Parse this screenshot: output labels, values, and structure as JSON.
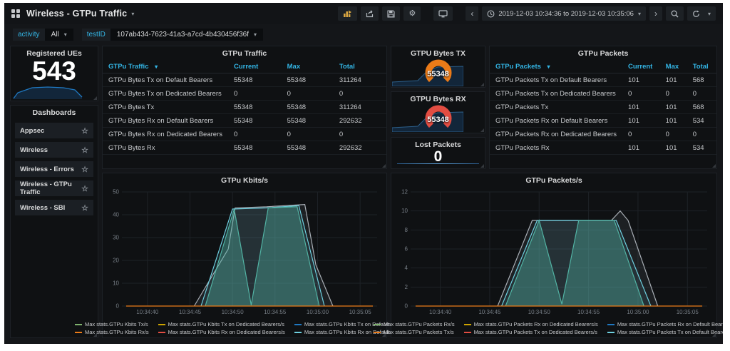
{
  "topnav": {
    "title": "Wireless - GTPu Traffic",
    "time_range": "2019-12-03 10:34:36 to 2019-12-03 10:35:06",
    "icons": [
      "add-panel",
      "share",
      "save",
      "settings",
      "cycle-view",
      "back",
      "clock",
      "forward",
      "zoom-out",
      "refresh"
    ]
  },
  "variables": [
    {
      "label": "activity",
      "value": "All"
    },
    {
      "label": "testID",
      "value": "107ab434-7623-41a3-a7cd-4b430456f36f"
    }
  ],
  "sidebar": {
    "registered_ues": {
      "title": "Registered UEs",
      "value": "543"
    },
    "dashboards": {
      "title": "Dashboards",
      "items": [
        "Appsec",
        "Wireless",
        "Wireless - Errors",
        "Wireless - GTPu Traffic",
        "Wireless - SBI"
      ]
    }
  },
  "traffic_table": {
    "title": "GTPu Traffic",
    "columns": [
      "GTPu Traffic",
      "Current",
      "Max",
      "Total"
    ],
    "rows": [
      {
        "name": "GTPu Bytes Tx on Default Bearers",
        "current": "55348",
        "max": "55348",
        "total": "311264"
      },
      {
        "name": "GTPu Bytes Tx on Dedicated Bearers",
        "current": "0",
        "max": "0",
        "total": "0"
      },
      {
        "name": "GTPu Bytes Tx",
        "current": "55348",
        "max": "55348",
        "total": "311264"
      },
      {
        "name": "GTPu Bytes Rx on Default Bearers",
        "current": "55348",
        "max": "55348",
        "total": "292632"
      },
      {
        "name": "GTPu Bytes Rx on Dedicated Bearers",
        "current": "0",
        "max": "0",
        "total": "0"
      },
      {
        "name": "GTPu Bytes Rx",
        "current": "55348",
        "max": "55348",
        "total": "292632"
      }
    ]
  },
  "packets_table": {
    "title": "GTPu Packets",
    "columns": [
      "GTPu Packets",
      "Current",
      "Max",
      "Total"
    ],
    "rows": [
      {
        "name": "GTPu Packets Tx on Default Bearers",
        "current": "101",
        "max": "101",
        "total": "568"
      },
      {
        "name": "GTPu Packets Tx on Dedicated Bearers",
        "current": "0",
        "max": "0",
        "total": "0"
      },
      {
        "name": "GTPu Packets Tx",
        "current": "101",
        "max": "101",
        "total": "568"
      },
      {
        "name": "GTPu Packets Rx on Default Bearers",
        "current": "101",
        "max": "101",
        "total": "534"
      },
      {
        "name": "GTPu Packets Rx on Dedicated Bearers",
        "current": "0",
        "max": "0",
        "total": "0"
      },
      {
        "name": "GTPu Packets Rx",
        "current": "101",
        "max": "101",
        "total": "534"
      }
    ]
  },
  "singlestats": {
    "tx": {
      "title": "GTPU Bytes TX",
      "value": "55348",
      "color": "#eb7b18"
    },
    "rx": {
      "title": "GTPU Bytes RX",
      "value": "55348",
      "color": "#e24d42"
    },
    "lost": {
      "title": "Lost Packets",
      "value": "0"
    }
  },
  "colors": {
    "accent_blue": "#33b5e5",
    "spark_line": "#1f78c1",
    "spark_fill": "#12263a",
    "grid": "#1e2227",
    "axis_text": "#767d85"
  },
  "chart_data": [
    {
      "type": "area",
      "title": "GTPu Kbits/s",
      "xlabel": "",
      "ylabel": "",
      "ylim": [
        0,
        50
      ],
      "yticks": [
        0,
        10,
        20,
        30,
        40,
        50
      ],
      "x_domain_seconds": [
        37,
        67
      ],
      "xticks": [
        {
          "s": 40,
          "label": "10:34:40"
        },
        {
          "s": 45,
          "label": "10:34:45"
        },
        {
          "s": 50,
          "label": "10:34:50"
        },
        {
          "s": 55,
          "label": "10:34:55"
        },
        {
          "s": 60,
          "label": "10:35:00"
        },
        {
          "s": 65,
          "label": "10:35:05"
        }
      ],
      "legend": [
        {
          "label": "Max stats.GTPu Kbits Tx/s",
          "color": "#7eb26d"
        },
        {
          "label": "Max stats.GTPu Kbits Tx on Dedicated Bearers/s",
          "color": "#cca300"
        },
        {
          "label": "Max stats.GTPu Kbits Tx on Default Bearers/s",
          "color": "#1f78c1"
        },
        {
          "label": "Max stats.GTPu Kbits Rx/s",
          "color": "#eb7b18"
        },
        {
          "label": "Max stats.GTPu Kbits Rx on Dedicated Bearers/s",
          "color": "#e24d42"
        },
        {
          "label": "Max stats.GTPu Kbits Rx on Default Bearers/s",
          "color": "#6ed0e0"
        }
      ],
      "series": [
        {
          "name": "Max stats.GTPu Kbits Rx/s",
          "color": "#a8aeb5",
          "fill": "rgba(160,168,176,0.10)",
          "points": [
            [
              45.5,
              0
            ],
            [
              49.5,
              25
            ],
            [
              50.3,
              43
            ],
            [
              54,
              43.5
            ],
            [
              58.5,
              44.5
            ],
            [
              59.8,
              18
            ],
            [
              61.8,
              0
            ]
          ]
        },
        {
          "name": "Max stats.GTPu Kbits Tx/s",
          "color": "#6ed0e0",
          "fill": "rgba(110,208,224,0.10)",
          "points": [
            [
              46.3,
              0
            ],
            [
              50,
              42.5
            ],
            [
              54,
              43
            ],
            [
              57.8,
              44
            ],
            [
              60.8,
              0
            ]
          ]
        },
        {
          "name": "Max stats.GTPu Kbits Tx on Default Bearers/s",
          "color": "#52b3a4",
          "fill": "rgba(82,179,164,0.38)",
          "points": [
            [
              46.8,
              0
            ],
            [
              50.2,
              42.5
            ],
            [
              52.2,
              0.4
            ],
            [
              54.2,
              43
            ],
            [
              57.6,
              43.5
            ],
            [
              60.2,
              0
            ]
          ]
        },
        {
          "name": "Max stats.GTPu Kbits Tx on Dedicated Bearers/s",
          "color": "#eb7b18",
          "fill": "none",
          "points": [
            [
              37.5,
              0
            ],
            [
              66.5,
              0
            ]
          ]
        }
      ]
    },
    {
      "type": "area",
      "title": "GTPu Packets/s",
      "xlabel": "",
      "ylabel": "",
      "ylim": [
        0,
        12
      ],
      "yticks": [
        0,
        2,
        4,
        6,
        8,
        10,
        12
      ],
      "x_domain_seconds": [
        37,
        67
      ],
      "xticks": [
        {
          "s": 40,
          "label": "10:34:40"
        },
        {
          "s": 45,
          "label": "10:34:45"
        },
        {
          "s": 50,
          "label": "10:34:50"
        },
        {
          "s": 55,
          "label": "10:34:55"
        },
        {
          "s": 60,
          "label": "10:35:00"
        },
        {
          "s": 65,
          "label": "10:35:05"
        }
      ],
      "legend": [
        {
          "label": "Max stats.GTPu Packets Rx/s",
          "color": "#7eb26d"
        },
        {
          "label": "Max stats.GTPu Packets Rx on Dedicated Bearers/s",
          "color": "#cca300"
        },
        {
          "label": "Max stats.GTPu Packets Rx on Default Bearers/s",
          "color": "#1f78c1"
        },
        {
          "label": "Max stats.GTPu Packets Tx/s",
          "color": "#eb7b18"
        },
        {
          "label": "Max stats.GTPu Packets Tx on Dedicated Bearers/s",
          "color": "#e24d42"
        },
        {
          "label": "Max stats.GTPu Packets Tx on Default Bearers/s",
          "color": "#6ed0e0"
        }
      ],
      "series": [
        {
          "name": "Max stats.GTPu Packets Rx/s",
          "color": "#a8aeb5",
          "fill": "rgba(160,168,176,0.10)",
          "points": [
            [
              45.8,
              0
            ],
            [
              49.3,
              9
            ],
            [
              57.3,
              9
            ],
            [
              58.2,
              10
            ],
            [
              59,
              9
            ],
            [
              62,
              0
            ]
          ]
        },
        {
          "name": "Max stats.GTPu Packets Tx/s",
          "color": "#6ed0e0",
          "fill": "rgba(110,208,224,0.10)",
          "points": [
            [
              46.2,
              0
            ],
            [
              49.8,
              9
            ],
            [
              57.8,
              9
            ],
            [
              61.3,
              0
            ]
          ]
        },
        {
          "name": "Max stats.GTPu Packets Tx on Default Bearers/s",
          "color": "#52b3a4",
          "fill": "rgba(82,179,164,0.38)",
          "points": [
            [
              46.6,
              0
            ],
            [
              50,
              9
            ],
            [
              52.3,
              0.2
            ],
            [
              54,
              9
            ],
            [
              57.6,
              9
            ],
            [
              60.6,
              0
            ]
          ]
        },
        {
          "name": "Max stats.GTPu Packets Tx on Dedicated Bearers/s",
          "color": "#eb7b18",
          "fill": "none",
          "points": [
            [
              37.5,
              0
            ],
            [
              66.5,
              0
            ]
          ]
        }
      ]
    }
  ]
}
